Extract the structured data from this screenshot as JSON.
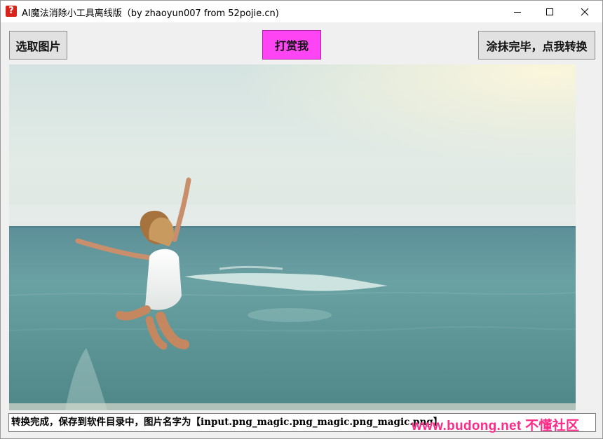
{
  "window": {
    "title": "AI魔法消除小工具离线版（by zhaoyun007 from 52pojie.cn)",
    "app_icon_glyph": "?"
  },
  "toolbar": {
    "pick_image_label": "选取图片",
    "tip_label": "打赏我",
    "convert_label": "涂抹完毕，点我转换"
  },
  "status_bar": {
    "message": "转换完成，保存到软件目录中，图片名字为【input.png_magic.png_magic.png_magic.png】"
  },
  "watermark": {
    "text": "www.budong.net 不懂社区"
  },
  "colors": {
    "tip_button_bg": "#ff45f3",
    "watermark": "#ff2a88",
    "sea": "#5f9a9b",
    "sky": "#dfe9e6"
  }
}
